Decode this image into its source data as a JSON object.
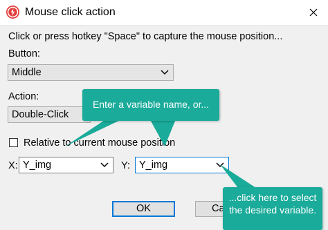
{
  "window": {
    "title": "Mouse click action"
  },
  "instructions": "Click or press hotkey \"Space\" to capture the mouse position...",
  "button_field": {
    "label": "Button:",
    "value": "Middle"
  },
  "action_field": {
    "label": "Action:",
    "value": "Double-Click"
  },
  "relative_checkbox": {
    "label": "Relative to current mouse position",
    "checked": false
  },
  "x_field": {
    "label": "X:",
    "value": "Y_img"
  },
  "y_field": {
    "label": "Y:",
    "value": "Y_img"
  },
  "buttons": {
    "ok": "OK",
    "cancel": "Cance"
  },
  "callouts": {
    "variable": "Enter a variable name, or...",
    "click_here": "...click here to select the desired variable."
  },
  "colors": {
    "callout": "#1aab9a",
    "focus_border": "#0078d7",
    "app_icon": "#e33b3b"
  }
}
